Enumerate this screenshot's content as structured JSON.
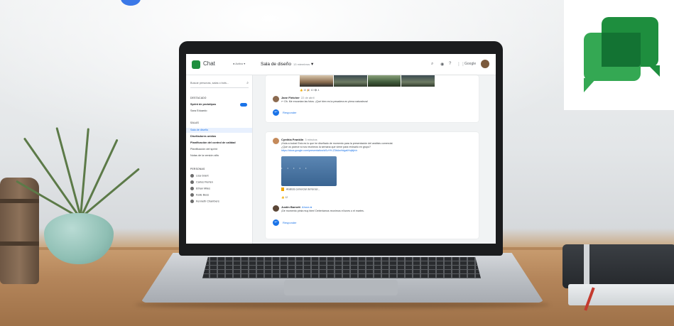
{
  "app": {
    "title": "Chat",
    "status": "● Activo ▾"
  },
  "search": {
    "placeholder": "Buscar personas, salas o bots..."
  },
  "sidebar": {
    "featured_header": "DESTACADO",
    "featured": [
      {
        "label": "Sprint de prototipos",
        "bold": true,
        "badge": true
      },
      {
        "label": "Sara Eduardo",
        "bold": false
      }
    ],
    "rooms_header": "SALAS",
    "rooms": [
      {
        "label": "Sala de diseño",
        "active": true
      },
      {
        "label": "Diseñadores unidos",
        "bold": true
      },
      {
        "label": "Planificación del control de calidad",
        "bold": true
      },
      {
        "label": "Planificación del sprint",
        "bold": false
      },
      {
        "label": "Notas de la versión alfa",
        "bold": false
      }
    ],
    "people_header": "PERSONAS",
    "people": [
      {
        "label": "Lisa Grant"
      },
      {
        "label": "Carlos Flerten"
      },
      {
        "label": "Ethan Miles"
      },
      {
        "label": "Katie Bess"
      },
      {
        "label": "Kenneth Chambers"
      }
    ]
  },
  "room": {
    "title": "Sala de diseño",
    "members": "13 miembros",
    "google_label": "Google"
  },
  "thread1": {
    "reactions": "👍 10   🎉 10   😂 4",
    "author": "Jane Fletcher",
    "time": "22 de abril",
    "text": "↩ Oh. Me encantan las fotos. ¡Qué bien es la pesadera en plena naturaleza!",
    "reply": "Responder"
  },
  "thread2": {
    "author": "Cynthia Franklin",
    "time": "3 minutos",
    "line1": "¡Hola a todos! Esto es lo que he diseñado de momento para la presentación del análisis comercial.",
    "line2": "¿Qué os parece si nos reunimos la semana que viene para revisarlo en grupo?",
    "link": "https://docs.google.com/presentation/d/1vYH-Z3bAwHdgaliHqfkjh/n",
    "file": "Análisis comercial del tercer...",
    "reactions": "👍 12",
    "reply_author": "Justin Barnett",
    "reply_time": "Ahora ●",
    "reply_text": "¡De momento pinta muy bien! Deberíamos reunirnos el lunes o el martes.",
    "reply": "Responder"
  },
  "colors": {
    "accent": "#1a73e8",
    "brand_green": "#1e8e3e",
    "brand_light_green": "#34a853"
  }
}
